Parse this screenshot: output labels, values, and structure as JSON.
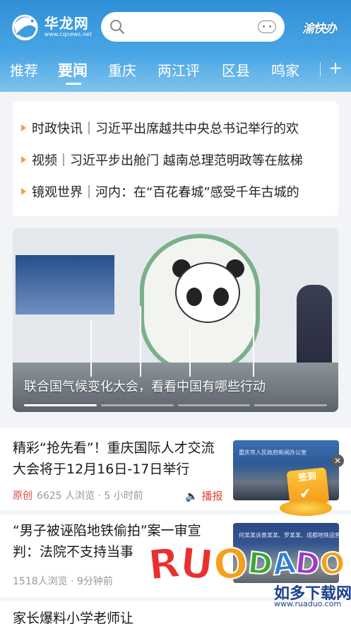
{
  "header": {
    "logo": {
      "name_cn": "华龙网",
      "domain": "www.cqnews.net"
    },
    "search": {
      "placeholder": "",
      "value": ""
    },
    "brand_right": "渝快办"
  },
  "tabs": [
    {
      "label": "推荐",
      "active": false
    },
    {
      "label": "要闻",
      "active": true
    },
    {
      "label": "重庆",
      "active": false
    },
    {
      "label": "两江评",
      "active": false
    },
    {
      "label": "区县",
      "active": false
    },
    {
      "label": "鸣家",
      "active": false
    }
  ],
  "tab_add": "+",
  "flash_news": [
    "时政快讯｜习近平出席越共中央总书记举行的欢",
    "视频｜习近平步出舱门 越南总理范明政等在舷梯",
    "镜观世界｜河内：在“百花春城”感受千年古城的"
  ],
  "banner": {
    "caption": "联合国气候变化大会，看看中国有哪些行动",
    "slides": 4,
    "active_slide": 1
  },
  "news": [
    {
      "title": "精彩“抢先看”！重庆国际人才交流大会将于12月16日-17日举行",
      "tag": "原创",
      "meta": "6625 人浏览 · 5 小时前",
      "action": "播报",
      "thumb_text": "重庆市人民政府新闻办公室"
    },
    {
      "title": "“男子被诬陷地铁偷拍”案一审宣判：法院不支持当事",
      "meta": "1518人浏览 · 9分钟前",
      "thumb_text": "何某某诉黄某某、罗某某、成都地铁运营有限公司"
    },
    {
      "title": "家长爆料小学老师让"
    }
  ],
  "signin_badge": {
    "label": "签到"
  },
  "close_label": "✕",
  "watermark": {
    "letters": [
      "R",
      "U",
      "O",
      "D",
      "A",
      "D",
      "O"
    ],
    "colors": [
      "#e8302f",
      "#e8302f",
      "#f4a01a",
      "#3aa935",
      "#2a7fd0",
      "#9b3cc4",
      "#f4a01a"
    ],
    "sub": "如多下载网",
    "url": "www.ruaduo.com"
  },
  "colors": {
    "header_top": "#2f8fd8",
    "accent_red": "#e0463c",
    "bullet": "#f0a23b"
  }
}
